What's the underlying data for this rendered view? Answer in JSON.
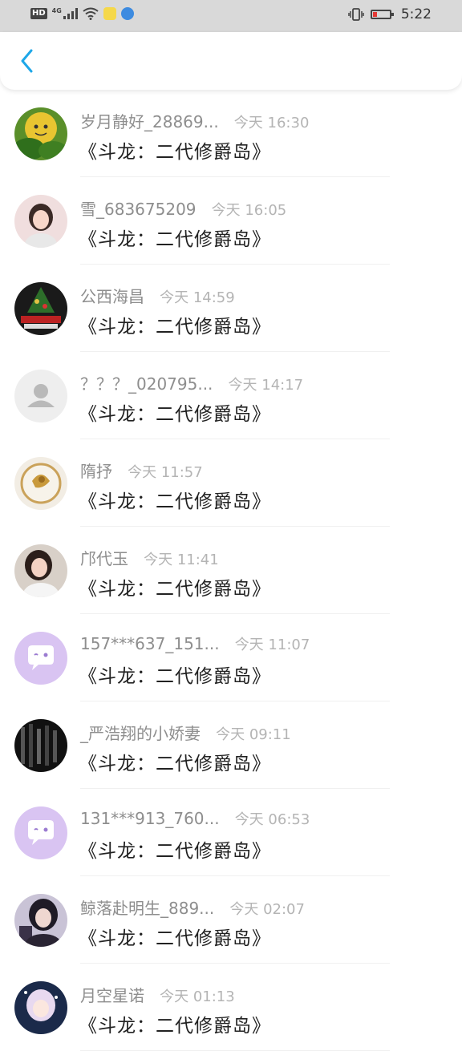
{
  "status_bar": {
    "hd": "HD",
    "network": "4G",
    "time": "5:22"
  },
  "colors": {
    "accent": "#1ea7e8",
    "battery_low": "#e53935",
    "name_text": "#8e8e8e",
    "time_text": "#b4b4b4"
  },
  "header": {
    "back_icon": "chevron-left-icon"
  },
  "items": [
    {
      "name": "岁月静好_28869...",
      "time": "今天 16:30",
      "message": "《斗龙：二代修爵岛》"
    },
    {
      "name": "雪_683675209",
      "time": "今天 16:05",
      "message": "《斗龙：二代修爵岛》"
    },
    {
      "name": "公西海昌",
      "time": "今天 14:59",
      "message": "《斗龙：二代修爵岛》"
    },
    {
      "name": "？？？_020795...",
      "time": "今天 14:17",
      "message": "《斗龙：二代修爵岛》"
    },
    {
      "name": "隋抒",
      "time": "今天 11:57",
      "message": "《斗龙：二代修爵岛》"
    },
    {
      "name": "邝代玉",
      "time": "今天 11:41",
      "message": "《斗龙：二代修爵岛》"
    },
    {
      "name": "157***637_151...",
      "time": "今天 11:07",
      "message": "《斗龙：二代修爵岛》"
    },
    {
      "name": "_严浩翔的小娇妻",
      "time": "今天 09:11",
      "message": "《斗龙：二代修爵岛》"
    },
    {
      "name": "131***913_760...",
      "time": "今天 06:53",
      "message": "《斗龙：二代修爵岛》"
    },
    {
      "name": "鲸落赴明生_889...",
      "time": "今天 02:07",
      "message": "《斗龙：二代修爵岛》"
    },
    {
      "name": "月空星诺",
      "time": "今天 01:13",
      "message": "《斗龙：二代修爵岛》"
    }
  ]
}
